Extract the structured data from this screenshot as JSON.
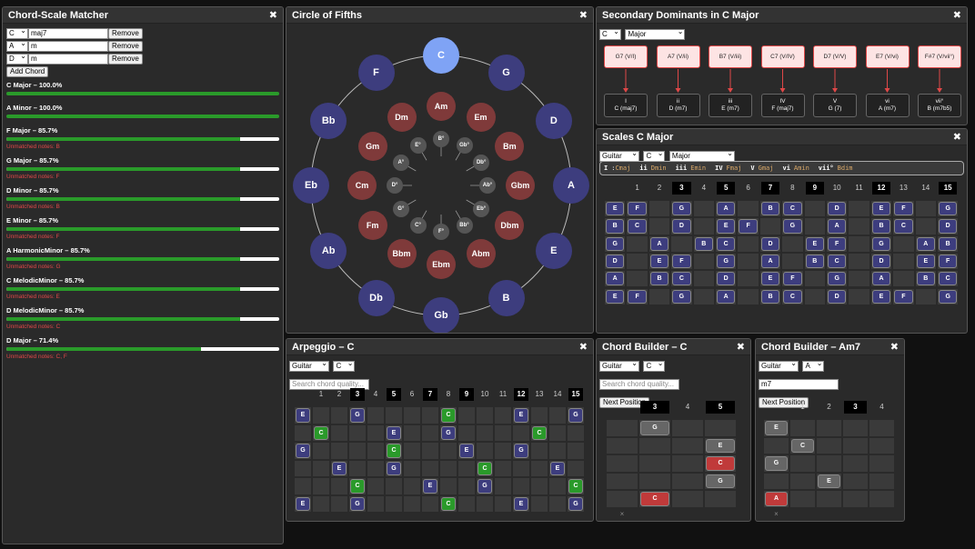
{
  "matcher": {
    "title": "Chord-Scale Matcher",
    "close": "✖",
    "inputs": [
      {
        "root": "C",
        "quality": "maj7"
      },
      {
        "root": "A",
        "quality": "m"
      },
      {
        "root": "D",
        "quality": "m"
      }
    ],
    "remove_label": "Remove",
    "add_label": "Add Chord",
    "results": [
      {
        "name": "C Major – 100.0%",
        "pct": 100,
        "unmatched": ""
      },
      {
        "name": "A Minor – 100.0%",
        "pct": 100,
        "unmatched": ""
      },
      {
        "name": "F Major – 85.7%",
        "pct": 85.7,
        "unmatched": "Unmatched notes: B"
      },
      {
        "name": "G Major – 85.7%",
        "pct": 85.7,
        "unmatched": "Unmatched notes: F"
      },
      {
        "name": "D Minor – 85.7%",
        "pct": 85.7,
        "unmatched": "Unmatched notes: B"
      },
      {
        "name": "E Minor – 85.7%",
        "pct": 85.7,
        "unmatched": "Unmatched notes: F"
      },
      {
        "name": "A HarmonicMinor – 85.7%",
        "pct": 85.7,
        "unmatched": "Unmatched notes: G"
      },
      {
        "name": "C MelodicMinor – 85.7%",
        "pct": 85.7,
        "unmatched": "Unmatched notes: E"
      },
      {
        "name": "D MelodicMinor – 85.7%",
        "pct": 85.7,
        "unmatched": "Unmatched notes: C"
      },
      {
        "name": "D Major – 71.4%",
        "pct": 71.4,
        "unmatched": "Unmatched notes: C, F"
      }
    ]
  },
  "circle": {
    "title": "Circle of Fifths",
    "close": "✖",
    "outer": [
      "C",
      "G",
      "D",
      "A",
      "E",
      "B",
      "Gb",
      "Db",
      "Ab",
      "Eb",
      "Bb",
      "F"
    ],
    "middle": [
      "Am",
      "Em",
      "Bm",
      "Gbm",
      "Dbm",
      "Abm",
      "Ebm",
      "Bbm",
      "Fm",
      "Cm",
      "Gm",
      "Dm"
    ],
    "inner": [
      "B°",
      "Gb°",
      "Db°",
      "Ab°",
      "Eb°",
      "Bb°",
      "F°",
      "C°",
      "G°",
      "D°",
      "A°",
      "E°"
    ],
    "colors": {
      "outer": "#3d3d7e",
      "selected": "#7fa3f5",
      "middle": "#7f3a3a",
      "inner": "#555555"
    }
  },
  "secdom": {
    "title": "Secondary Dominants in C Major",
    "close": "✖",
    "root": "C",
    "mode": "Major",
    "dominants": [
      "G7 (V/I)",
      "A7 (V/ii)",
      "B7 (V/iii)",
      "C7 (V/IV)",
      "D7 (V/V)",
      "E7 (V/vi)",
      "F#7 (V/vii°)"
    ],
    "targets": [
      {
        "r": "I",
        "c": "C (maj7)"
      },
      {
        "r": "ii",
        "c": "D (m7)"
      },
      {
        "r": "iii",
        "c": "E (m7)"
      },
      {
        "r": "IV",
        "c": "F (maj7)"
      },
      {
        "r": "V",
        "c": "G (7)"
      },
      {
        "r": "vi",
        "c": "A (m7)"
      },
      {
        "r": "vii°",
        "c": "B (m7b5)"
      }
    ]
  },
  "scales": {
    "title": "Scales C Major",
    "close": "✖",
    "instrument": "Guitar",
    "root": "C",
    "mode": "Major",
    "degrees": [
      {
        "r": "I",
        "c": "Cmaj"
      },
      {
        "r": "ii",
        "c": "Dmin"
      },
      {
        "r": "iii",
        "c": "Emin"
      },
      {
        "r": "IV",
        "c": "Fmaj"
      },
      {
        "r": "V",
        "c": "Gmaj"
      },
      {
        "r": "vi",
        "c": "Amin"
      },
      {
        "r": "vii°",
        "c": "Bdim"
      }
    ],
    "frets": [
      "1",
      "2",
      "3",
      "4",
      "5",
      "6",
      "7",
      "8",
      "9",
      "10",
      "11",
      "12",
      "13",
      "14",
      "15"
    ],
    "hl": [
      3,
      5,
      7,
      9,
      12,
      15
    ],
    "strings": [
      [
        [
          0,
          "E"
        ],
        [
          1,
          "F"
        ],
        [
          3,
          "G"
        ],
        [
          5,
          "A"
        ],
        [
          7,
          "B"
        ],
        [
          8,
          "C"
        ],
        [
          10,
          "D"
        ],
        [
          12,
          "E"
        ],
        [
          13,
          "F"
        ],
        [
          15,
          "G"
        ]
      ],
      [
        [
          0,
          "B"
        ],
        [
          1,
          "C"
        ],
        [
          3,
          "D"
        ],
        [
          5,
          "E"
        ],
        [
          6,
          "F"
        ],
        [
          8,
          "G"
        ],
        [
          10,
          "A"
        ],
        [
          12,
          "B"
        ],
        [
          13,
          "C"
        ],
        [
          15,
          "D"
        ]
      ],
      [
        [
          0,
          "G"
        ],
        [
          2,
          "A"
        ],
        [
          4,
          "B"
        ],
        [
          5,
          "C"
        ],
        [
          7,
          "D"
        ],
        [
          9,
          "E"
        ],
        [
          10,
          "F"
        ],
        [
          12,
          "G"
        ],
        [
          14,
          "A"
        ],
        [
          15,
          "B"
        ]
      ],
      [
        [
          0,
          "D"
        ],
        [
          2,
          "E"
        ],
        [
          3,
          "F"
        ],
        [
          5,
          "G"
        ],
        [
          7,
          "A"
        ],
        [
          9,
          "B"
        ],
        [
          10,
          "C"
        ],
        [
          12,
          "D"
        ],
        [
          14,
          "E"
        ],
        [
          15,
          "F"
        ]
      ],
      [
        [
          0,
          "A"
        ],
        [
          2,
          "B"
        ],
        [
          3,
          "C"
        ],
        [
          5,
          "D"
        ],
        [
          7,
          "E"
        ],
        [
          8,
          "F"
        ],
        [
          10,
          "G"
        ],
        [
          12,
          "A"
        ],
        [
          14,
          "B"
        ],
        [
          15,
          "C"
        ]
      ],
      [
        [
          0,
          "E"
        ],
        [
          1,
          "F"
        ],
        [
          3,
          "G"
        ],
        [
          5,
          "A"
        ],
        [
          7,
          "B"
        ],
        [
          8,
          "C"
        ],
        [
          10,
          "D"
        ],
        [
          12,
          "E"
        ],
        [
          13,
          "F"
        ],
        [
          15,
          "G"
        ]
      ]
    ]
  },
  "arpeggio": {
    "title": "Arpeggio – C",
    "close": "✖",
    "instrument": "Guitar",
    "root": "C",
    "search_placeholder": "Search chord quality...",
    "frets": [
      "1",
      "2",
      "3",
      "4",
      "5",
      "6",
      "7",
      "8",
      "9",
      "10",
      "11",
      "12",
      "13",
      "14",
      "15"
    ],
    "hl": [
      3,
      5,
      7,
      9,
      12,
      15
    ],
    "strings": [
      [
        [
          0,
          "E",
          "b"
        ],
        [
          3,
          "G",
          "b"
        ],
        [
          8,
          "C",
          "g"
        ],
        [
          12,
          "E",
          "b"
        ],
        [
          15,
          "G",
          "b"
        ]
      ],
      [
        [
          1,
          "C",
          "g"
        ],
        [
          5,
          "E",
          "b"
        ],
        [
          8,
          "G",
          "b"
        ],
        [
          13,
          "C",
          "g"
        ]
      ],
      [
        [
          0,
          "G",
          "b"
        ],
        [
          5,
          "C",
          "g"
        ],
        [
          9,
          "E",
          "b"
        ],
        [
          12,
          "G",
          "b"
        ]
      ],
      [
        [
          2,
          "E",
          "b"
        ],
        [
          5,
          "G",
          "b"
        ],
        [
          10,
          "C",
          "g"
        ],
        [
          14,
          "E",
          "b"
        ]
      ],
      [
        [
          3,
          "C",
          "g"
        ],
        [
          7,
          "E",
          "b"
        ],
        [
          10,
          "G",
          "b"
        ],
        [
          15,
          "C",
          "g"
        ]
      ],
      [
        [
          0,
          "E",
          "b"
        ],
        [
          3,
          "G",
          "b"
        ],
        [
          8,
          "C",
          "g"
        ],
        [
          12,
          "E",
          "b"
        ],
        [
          15,
          "G",
          "b"
        ]
      ]
    ]
  },
  "cb1": {
    "title": "Chord Builder – C",
    "close": "✖",
    "instrument": "Guitar",
    "root": "C",
    "search_placeholder": "Search chord quality...",
    "next_label": "Next Position",
    "frets": [
      "3",
      "4",
      "5"
    ],
    "hl": [
      0,
      2
    ],
    "notes": [
      [
        0,
        0,
        "G",
        "g"
      ],
      [
        1,
        2,
        "E",
        "g"
      ],
      [
        2,
        2,
        "C",
        "r"
      ],
      [
        3,
        2,
        "G",
        "g"
      ],
      [
        4,
        0,
        "C",
        "r"
      ]
    ],
    "mute": "×"
  },
  "cb2": {
    "title": "Chord Builder – Am7",
    "close": "✖",
    "instrument": "Guitar",
    "root": "A",
    "quality": "m7",
    "next_label": "Next Position",
    "frets": [
      "1",
      "2",
      "3",
      "4"
    ],
    "hl": [
      2
    ],
    "notes": [
      [
        0,
        0,
        "E",
        "g"
      ],
      [
        1,
        1,
        "C",
        "g"
      ],
      [
        2,
        0,
        "G",
        "g"
      ],
      [
        3,
        2,
        "E",
        "g"
      ],
      [
        4,
        0,
        "A",
        "r"
      ]
    ],
    "mute": "×"
  }
}
